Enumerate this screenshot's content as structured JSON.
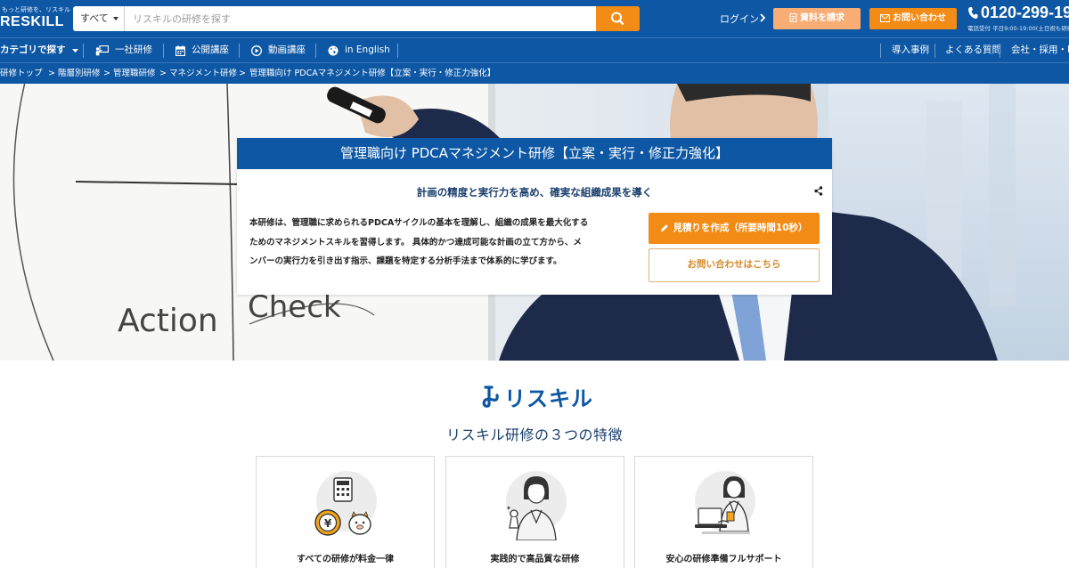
{
  "header": {
    "logo_tagline": "もっと研修を、リスキル",
    "logo_name": "RESKILL",
    "search_category": "すべて",
    "search_placeholder": "リスキルの研修を探す",
    "login_label": "ログイン",
    "request_docs_label": "資料を請求",
    "contact_label": "お問い合わせ",
    "phone_number": "0120-299-19",
    "phone_hours": "電話受付 平日9:00-19:00(土日祝も研修"
  },
  "nav": {
    "items": [
      {
        "label": "カテゴリで探す"
      },
      {
        "label": "一社研修"
      },
      {
        "label": "公開講座"
      },
      {
        "label": "動画講座"
      },
      {
        "label": "in English"
      }
    ],
    "right_items": [
      {
        "label": "導入事例"
      },
      {
        "label": "よくある質問"
      },
      {
        "label": "会社・採用・IR"
      }
    ]
  },
  "breadcrumb": [
    {
      "label": "研修トップ"
    },
    {
      "label": "階層別研修"
    },
    {
      "label": "管理職研修"
    },
    {
      "label": "マネジメント研修"
    },
    {
      "label": "管理職向け PDCAマネジメント研修【立案・実行・修正力強化】"
    }
  ],
  "hero": {
    "title": "管理職向け PDCAマネジメント研修【立案・実行・修正力強化】",
    "subtitle": "計画の精度と実行力を高め、確実な組織成果を導く",
    "description_lines": [
      "本研修は、管理職に求められるPDCAサイクルの基本を理解し、組織の成果を最大化する",
      "ためのマネジメントスキルを習得します。 具体的かつ達成可能な計画の立て方から、メ",
      "ンバーの実行力を引き出す指示、課題を特定する分析手法まで体系的に学びます。"
    ],
    "estimate_button": "見積りを作成（所要時間10秒）",
    "inquiry_button": "お問い合わせはこちら",
    "board_words": [
      "Action",
      "Check"
    ]
  },
  "features": {
    "brand": "リスキル",
    "heading": "リスキル研修の３つの特徴",
    "cards": [
      {
        "label": "すべての研修が料金一律",
        "icon": "calculator-coin-icon"
      },
      {
        "label": "実践的で高品質な研修",
        "icon": "instructor-icon"
      },
      {
        "label": "安心の研修準備フルサポート",
        "icon": "support-staff-icon"
      }
    ]
  },
  "colors": {
    "primary": "#0d57a4",
    "accent": "#f28c16",
    "accent_light": "#f7ad73"
  }
}
